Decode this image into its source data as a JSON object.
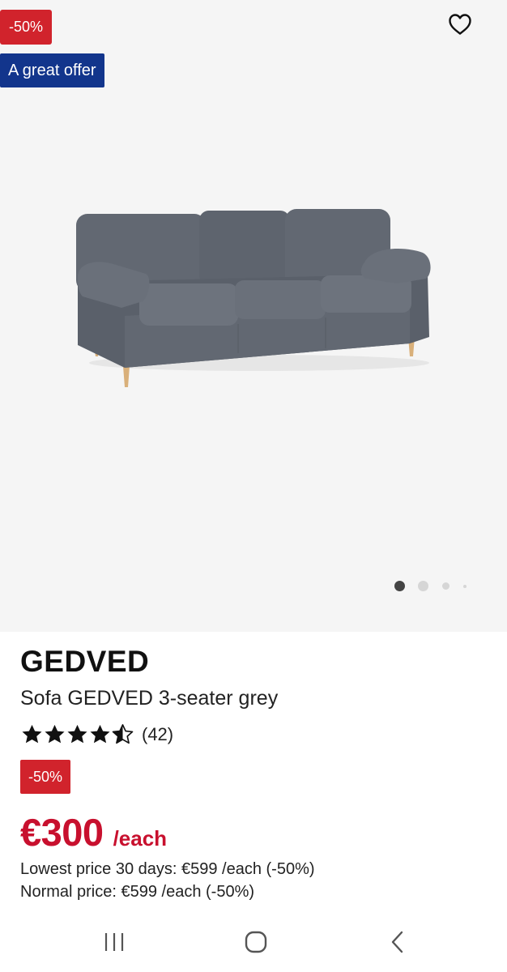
{
  "gallery": {
    "discount_badge": "-50%",
    "offer_badge": "A great offer",
    "wishlist_icon": "heart-outline-icon",
    "image_alt": "grey 3-seater sofa",
    "slide_count": 4,
    "active_slide": 1
  },
  "product": {
    "brand": "GEDVED",
    "title": "Sofa GEDVED 3-seater grey",
    "rating": 4.5,
    "rating_count": "(42)",
    "discount_badge": "-50%",
    "price": "€300",
    "price_unit": "/each",
    "lowest_price": "Lowest price 30 days: €599 /each (-50%)",
    "normal_price": "Normal price: €599 /each (-50%)"
  },
  "nav": {
    "recents_icon": "recents-icon",
    "home_icon": "home-icon",
    "back_icon": "back-icon"
  },
  "colors": {
    "discount_red": "#d1232c",
    "offer_blue": "#12358c",
    "price_red": "#c8102e",
    "gallery_bg": "#f5f5f5"
  }
}
